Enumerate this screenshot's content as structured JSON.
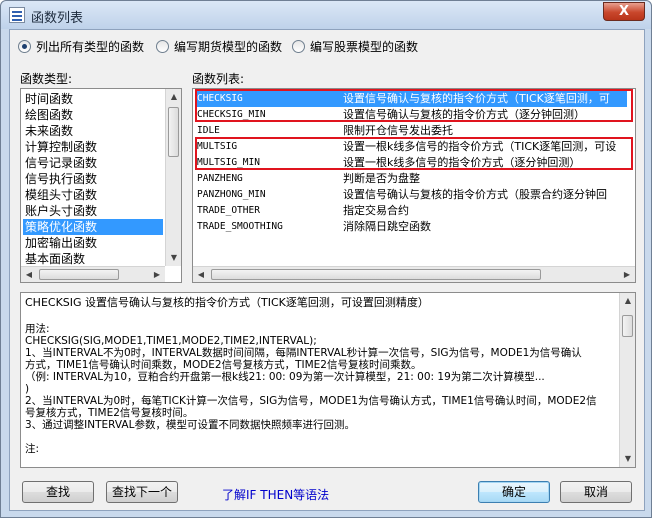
{
  "window": {
    "title": "函数列表",
    "close_label": "X"
  },
  "radio_options": [
    {
      "label": "列出所有类型的函数",
      "selected": true
    },
    {
      "label": "编写期货模型的函数",
      "selected": false
    },
    {
      "label": "编写股票模型的函数",
      "selected": false
    }
  ],
  "types_panel": {
    "label": "函数类型:",
    "items": [
      "时间函数",
      "绘图函数",
      "未来函数",
      "计算控制函数",
      "信号记录函数",
      "信号执行函数",
      "模组头寸函数",
      "账户头寸函数",
      "策略优化函数",
      "加密输出函数",
      "基本面函数"
    ],
    "selected_index": 8
  },
  "functions_panel": {
    "label": "函数列表:",
    "rows": [
      {
        "name": "CHECKSIG",
        "desc": "设置信号确认与复核的指令价方式（TICK逐笔回测，可"
      },
      {
        "name": "CHECKSIG_MIN",
        "desc": "设置信号确认与复核的指令价方式（逐分钟回测）"
      },
      {
        "name": "IDLE",
        "desc": "限制开仓信号发出委托"
      },
      {
        "name": "MULTSIG",
        "desc": "设置一根k线多信号的指令价方式（TICK逐笔回测，可设"
      },
      {
        "name": "MULTSIG_MIN",
        "desc": "设置一根k线多信号的指令价方式（逐分钟回测）"
      },
      {
        "name": "PANZHENG",
        "desc": "判断是否为盘整"
      },
      {
        "name": "PANZHONG_MIN",
        "desc": "设置信号确认与复核的指令价方式（股票合约逐分钟回"
      },
      {
        "name": "TRADE_OTHER",
        "desc": "指定交易合约"
      },
      {
        "name": "TRADE_SMOOTHING",
        "desc": "消除隔日跳空函数"
      }
    ],
    "selected_index": 0
  },
  "description": {
    "lines": [
      "CHECKSIG 设置信号确认与复核的指令价方式（TICK逐笔回测，可设置回测精度）",
      "",
      "用法:",
      "CHECKSIG(SIG,MODE1,TIME1,MODE2,TIME2,INTERVAL);",
      "1、当INTERVAL不为0时，INTERVAL数据时间间隔，每隔INTERVAL秒计算一次信号，SIG为信号，MODE1为信号确认",
      "方式，TIME1信号确认时间乘数，MODE2信号复核方式，TIME2信号复核时间乘数。",
      "（例: INTERVAL为10，豆粕合约开盘第一根k线21: 00: 09为第一次计算模型，21: 00: 19为第二次计算模型...",
      ")",
      "2、当INTERVAL为0时，每笔TICK计算一次信号，SIG为信号，MODE1为信号确认方式，TIME1信号确认时间，MODE2信",
      "号复核方式，TIME2信号复核时间。",
      "3、通过调整INTERVAL参数，模型可设置不同数据快照频率进行回测。",
      "",
      "注:"
    ]
  },
  "buttons": {
    "find": "查找",
    "find_next": "查找下一个",
    "help_link": "了解IF THEN等语法",
    "ok": "确定",
    "cancel": "取消"
  }
}
